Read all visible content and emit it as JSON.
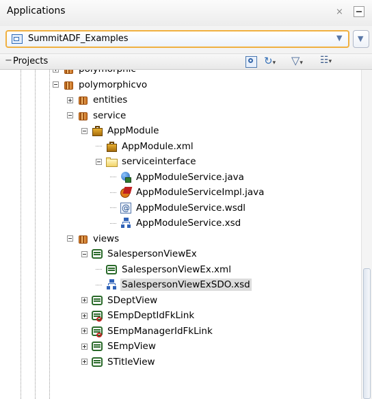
{
  "panel": {
    "title": "Applications",
    "close_glyph": "×"
  },
  "app_selector": {
    "value": "SummitADF_Examples"
  },
  "projects_header": {
    "label": "Projects"
  },
  "tree": [
    {
      "label": "polymorphic",
      "icon": "package-icon",
      "level": 4,
      "exp": "plus"
    },
    {
      "label": "polymorphicvo",
      "icon": "package-icon",
      "level": 4,
      "exp": "minus"
    },
    {
      "label": "entities",
      "icon": "package-icon",
      "level": 5,
      "exp": "plus"
    },
    {
      "label": "service",
      "icon": "package-icon",
      "level": 5,
      "exp": "minus"
    },
    {
      "label": "AppModule",
      "icon": "app-module-icon",
      "level": 6,
      "exp": "minus"
    },
    {
      "label": "AppModule.xml",
      "icon": "app-module-xml-icon",
      "level": 7,
      "exp": ""
    },
    {
      "label": "serviceinterface",
      "icon": "folder-icon",
      "level": 7,
      "exp": "minus"
    },
    {
      "label": "AppModuleService.java",
      "icon": "java-service-icon",
      "level": 8,
      "exp": ""
    },
    {
      "label": "AppModuleServiceImpl.java",
      "icon": "java-impl-icon",
      "level": 8,
      "exp": ""
    },
    {
      "label": "AppModuleService.wsdl",
      "icon": "wsdl-icon",
      "level": 8,
      "exp": ""
    },
    {
      "label": "AppModuleService.xsd",
      "icon": "xsd-icon",
      "level": 8,
      "exp": ""
    },
    {
      "label": "views",
      "icon": "package-icon",
      "level": 5,
      "exp": "minus"
    },
    {
      "label": "SalespersonViewEx",
      "icon": "view-object-icon",
      "level": 6,
      "exp": "minus"
    },
    {
      "label": "SalespersonViewEx.xml",
      "icon": "view-object-icon",
      "level": 7,
      "exp": ""
    },
    {
      "label": "SalespersonViewExSDO.xsd",
      "icon": "xsd-icon",
      "level": 7,
      "exp": "",
      "selected": true
    },
    {
      "label": "SDeptView",
      "icon": "view-object-icon",
      "level": 6,
      "exp": "plus"
    },
    {
      "label": "SEmpDeptIdFkLink",
      "icon": "view-link-icon",
      "level": 6,
      "exp": "plus"
    },
    {
      "label": "SEmpManagerIdFkLink",
      "icon": "view-link-icon",
      "level": 6,
      "exp": "plus"
    },
    {
      "label": "SEmpView",
      "icon": "view-object-icon",
      "level": 6,
      "exp": "plus"
    },
    {
      "label": "STitleView",
      "icon": "view-object-icon",
      "level": 6,
      "exp": "plus"
    }
  ]
}
